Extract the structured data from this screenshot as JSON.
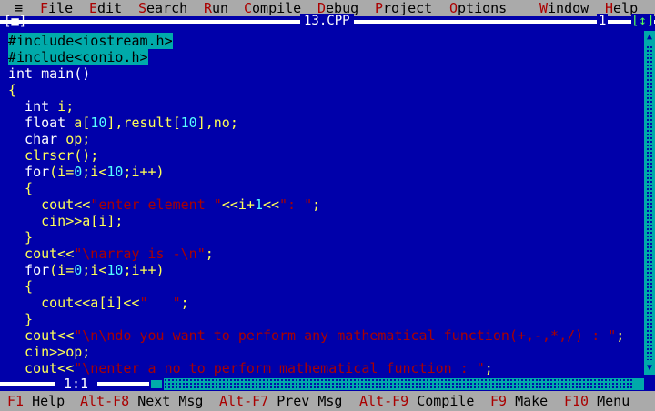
{
  "menu": {
    "system_icon": "≡",
    "items": [
      {
        "hot": "F",
        "rest": "ile"
      },
      {
        "hot": "E",
        "rest": "dit"
      },
      {
        "hot": "S",
        "rest": "earch"
      },
      {
        "hot": "R",
        "rest": "un"
      },
      {
        "hot": "C",
        "rest": "ompile"
      },
      {
        "hot": "D",
        "rest": "ebug"
      },
      {
        "hot": "P",
        "rest": "roject"
      },
      {
        "hot": "O",
        "rest": "ptions"
      },
      {
        "hot": "W",
        "rest": "indow"
      },
      {
        "hot": "H",
        "rest": "elp"
      }
    ]
  },
  "window": {
    "close": "[■]",
    "title": "13.CPP",
    "number": "1",
    "zoom": "[↕]"
  },
  "code": [
    [
      {
        "t": "#include<iostream.h>",
        "c": "pp"
      }
    ],
    [
      {
        "t": "#include<conio.h>",
        "c": "pp"
      }
    ],
    [
      {
        "t": "int main()",
        "c": "kw"
      }
    ],
    [
      {
        "t": "{",
        "c": "yl"
      }
    ],
    [
      {
        "t": "  int ",
        "c": "kw"
      },
      {
        "t": "i;",
        "c": "yl"
      }
    ],
    [
      {
        "t": "  float ",
        "c": "kw"
      },
      {
        "t": "a[",
        "c": "yl"
      },
      {
        "t": "10",
        "c": "nm"
      },
      {
        "t": "],result[",
        "c": "yl"
      },
      {
        "t": "10",
        "c": "nm"
      },
      {
        "t": "],no;",
        "c": "yl"
      }
    ],
    [
      {
        "t": "  char ",
        "c": "kw"
      },
      {
        "t": "op;",
        "c": "yl"
      }
    ],
    [
      {
        "t": "  clrscr();",
        "c": "yl"
      }
    ],
    [
      {
        "t": "  for",
        "c": "kw"
      },
      {
        "t": "(i=",
        "c": "yl"
      },
      {
        "t": "0",
        "c": "nm"
      },
      {
        "t": ";i<",
        "c": "yl"
      },
      {
        "t": "10",
        "c": "nm"
      },
      {
        "t": ";i++)",
        "c": "yl"
      }
    ],
    [
      {
        "t": "  {",
        "c": "yl"
      }
    ],
    [
      {
        "t": "    cout<<",
        "c": "yl"
      },
      {
        "t": "\"enter element \"",
        "c": "st"
      },
      {
        "t": "<<i+",
        "c": "yl"
      },
      {
        "t": "1",
        "c": "nm"
      },
      {
        "t": "<<",
        "c": "yl"
      },
      {
        "t": "\": \"",
        "c": "st"
      },
      {
        "t": ";",
        "c": "yl"
      }
    ],
    [
      {
        "t": "    cin>>a[i];",
        "c": "yl"
      }
    ],
    [
      {
        "t": "  }",
        "c": "yl"
      }
    ],
    [
      {
        "t": "  cout<<",
        "c": "yl"
      },
      {
        "t": "\"\\narray is -\\n\"",
        "c": "st"
      },
      {
        "t": ";",
        "c": "yl"
      }
    ],
    [
      {
        "t": "  for",
        "c": "kw"
      },
      {
        "t": "(i=",
        "c": "yl"
      },
      {
        "t": "0",
        "c": "nm"
      },
      {
        "t": ";i<",
        "c": "yl"
      },
      {
        "t": "10",
        "c": "nm"
      },
      {
        "t": ";i++)",
        "c": "yl"
      }
    ],
    [
      {
        "t": "  {",
        "c": "yl"
      }
    ],
    [
      {
        "t": "    cout<<a[i]<<",
        "c": "yl"
      },
      {
        "t": "\"   \"",
        "c": "st"
      },
      {
        "t": ";",
        "c": "yl"
      }
    ],
    [
      {
        "t": "  }",
        "c": "yl"
      }
    ],
    [
      {
        "t": "  cout<<",
        "c": "yl"
      },
      {
        "t": "\"\\n\\ndo you want to perform any mathematical function(+,-,*,/) : \"",
        "c": "st"
      },
      {
        "t": ";",
        "c": "yl"
      }
    ],
    [
      {
        "t": "  cin>>op;",
        "c": "yl"
      }
    ],
    [
      {
        "t": "  cout<<",
        "c": "yl"
      },
      {
        "t": "\"\\nenter a no to perform mathematical function : \"",
        "c": "st"
      },
      {
        "t": ";",
        "c": "yl"
      }
    ]
  ],
  "cursor_position": "1:1",
  "status": [
    {
      "key": "F1",
      "label": " Help"
    },
    {
      "key": "Alt-F8",
      "label": " Next Msg"
    },
    {
      "key": "Alt-F7",
      "label": " Prev Msg"
    },
    {
      "key": "Alt-F9",
      "label": " Compile"
    },
    {
      "key": "F9",
      "label": " Make"
    },
    {
      "key": "F10",
      "label": " Menu"
    }
  ],
  "colors": {
    "background": "#0000aa",
    "menu": "#aaaaaa",
    "hotkey": "#aa0000",
    "code": "#ffff55",
    "keyword": "#ffffff",
    "string": "#aa0000",
    "number": "#55ffff",
    "selection": "#00aaaa"
  }
}
